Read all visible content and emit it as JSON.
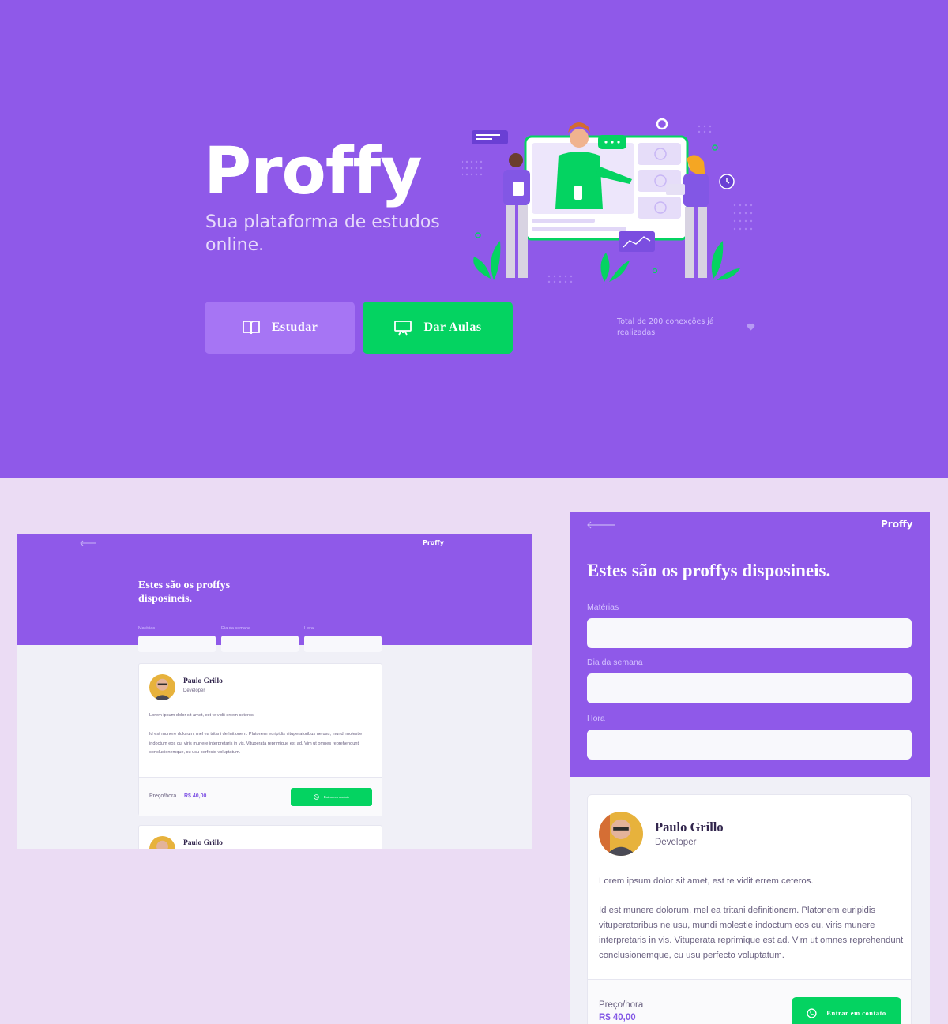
{
  "hero": {
    "logo": "Proffy",
    "tagline": "Sua plataforma de estudos online.",
    "study_button": "Estudar",
    "teach_button": "Dar Aulas",
    "connections": "Total de 200 conexções já realizadas"
  },
  "desktop": {
    "logo": "Proffy",
    "title": "Estes são os proffys disposineis.",
    "filters": [
      "Matérias",
      "Dia da semana",
      "Hora"
    ],
    "card": {
      "name": "Paulo Grillo",
      "role": "Developer",
      "bio_1": "Lorem ipsum dolor sit amet, est te vidit errem ceteros.",
      "bio_2": "Id est munere dolorum, mel ea tritani definitionem. Platonem euripidis vituperatoribus ne usu, mundi molestie indoctum eos cu, viris munere interpretaris in vis. Vituperata reprimique est ad. Vim ut omnes reprehendunt conclusionemque, cu usu perfecto voluptatum.",
      "price_label": "Preço/hora",
      "price": "R$ 40,00",
      "contact": "Entrar em contato"
    },
    "card2": {
      "name": "Paulo Grillo"
    }
  },
  "mobile": {
    "logo": "Proffy",
    "title": "Estes são os proffys disposineis.",
    "filters": [
      "Matérias",
      "Dia da semana",
      "Hora"
    ],
    "card": {
      "name": "Paulo Grillo",
      "role": "Developer",
      "bio_1": "Lorem ipsum dolor sit amet, est te vidit errem ceteros.",
      "bio_2": "Id est munere dolorum, mel ea tritani definitionem. Platonem euripidis vituperatoribus ne usu, mundi molestie indoctum eos cu, viris munere interpretaris in vis. Vituperata reprimique est ad. Vim ut omnes reprehendunt conclusionemque, cu usu perfecto voluptatum.",
      "price_label": "Preço/hora",
      "price": "R$ 40,00",
      "contact": "Entrar em contato"
    }
  },
  "colors": {
    "primary": "#8F59E9",
    "primary_light": "#A675F4",
    "secondary": "#04D361",
    "background": "#EBDCF4",
    "text_title": "#32264D",
    "text_body": "#6A6180"
  },
  "icons": [
    "book-open-icon",
    "presentation-icon",
    "heart-icon",
    "arrow-left-icon",
    "whatsapp-icon",
    "avatar"
  ]
}
